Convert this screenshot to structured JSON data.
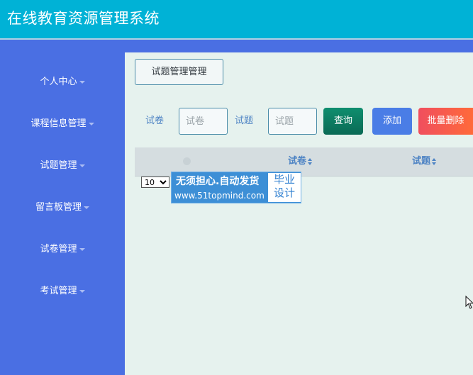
{
  "app": {
    "title": "在线教育资源管理系统"
  },
  "sidebar": {
    "items": [
      {
        "label": "个人中心"
      },
      {
        "label": "课程信息管理"
      },
      {
        "label": "试题管理"
      },
      {
        "label": "留言板管理"
      },
      {
        "label": "试卷管理"
      },
      {
        "label": "考试管理"
      }
    ]
  },
  "breadcrumb": {
    "label": "试题管理管理"
  },
  "search": {
    "paper_label": "试卷",
    "paper_placeholder": "试卷",
    "question_label": "试题",
    "question_placeholder": "试题"
  },
  "actions": {
    "query": "查询",
    "add": "添加",
    "batch_delete": "批量删除"
  },
  "table": {
    "columns": [
      "试卷",
      "试题"
    ]
  },
  "pagination": {
    "page_size": "10"
  },
  "watermark": {
    "line1": "无须担心.自动发货",
    "line2": "www.51topmind.com",
    "badge_line1": "毕业",
    "badge_line2": "设计"
  }
}
